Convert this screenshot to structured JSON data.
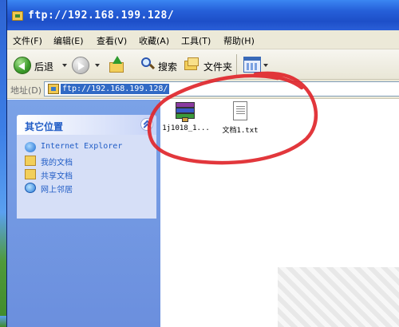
{
  "window": {
    "title": "ftp://192.168.199.128/"
  },
  "menubar": {
    "items": [
      {
        "id": "file",
        "label": "文件(F)"
      },
      {
        "id": "edit",
        "label": "编辑(E)"
      },
      {
        "id": "view",
        "label": "查看(V)"
      },
      {
        "id": "favorites",
        "label": "收藏(A)"
      },
      {
        "id": "tools",
        "label": "工具(T)"
      },
      {
        "id": "help",
        "label": "帮助(H)"
      }
    ]
  },
  "toolbar": {
    "back_label": "后退",
    "search_label": "搜索",
    "folders_label": "文件夹"
  },
  "address": {
    "label": "地址(D)",
    "value": "ftp://192.168.199.128/"
  },
  "taskpane": {
    "title": "其它位置",
    "items": [
      {
        "label": "Internet Explorer",
        "icon": "internet-explorer-icon"
      },
      {
        "label": "我的文档",
        "icon": "folder-icon"
      },
      {
        "label": "共享文档",
        "icon": "folder-icon"
      },
      {
        "label": "网上邻居",
        "icon": "network-icon"
      }
    ]
  },
  "files": [
    {
      "name": "1j1018_1...",
      "icon": "winrar-archive-icon"
    },
    {
      "name": "文档1.txt",
      "icon": "text-file-icon"
    }
  ],
  "colors": {
    "titlebar": "#2660d9",
    "taskpane": "#7ba2e7",
    "link": "#215dc6",
    "selection": "#316ac5",
    "annotation": "#e0262b"
  }
}
